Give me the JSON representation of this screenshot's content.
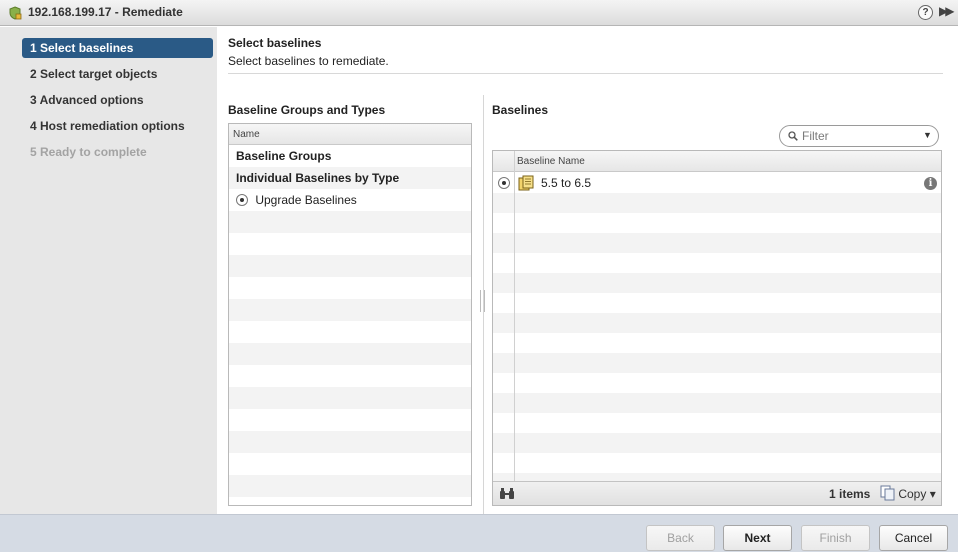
{
  "window": {
    "title": "192.168.199.17 - Remediate",
    "help_glyph": "?",
    "expand_glyph": "▶▶"
  },
  "steps": [
    {
      "label": "1  Select baselines",
      "state": "active"
    },
    {
      "label": "2  Select target objects",
      "state": "normal"
    },
    {
      "label": "3  Advanced options",
      "state": "normal"
    },
    {
      "label": "4  Host remediation options",
      "state": "normal"
    },
    {
      "label": "5  Ready to complete",
      "state": "disabled"
    }
  ],
  "main": {
    "heading": "Select baselines",
    "subheading": "Select baselines to remediate."
  },
  "left_panel": {
    "title": "Baseline Groups and Types",
    "column_header": "Name",
    "rows": [
      {
        "label": "Baseline Groups",
        "bold": true,
        "radio": false
      },
      {
        "label": "Individual Baselines by Type",
        "bold": true,
        "radio": false
      },
      {
        "label": "Upgrade Baselines",
        "bold": false,
        "radio": true
      }
    ]
  },
  "right_panel": {
    "title": "Baselines",
    "filter_placeholder": "Filter",
    "column_header": "Baseline Name",
    "rows": [
      {
        "name": "5.5 to 6.5",
        "icon": "upgrade-baseline-icon"
      }
    ],
    "items_count": "1 items",
    "copy_label": "Copy ▾"
  },
  "buttons": {
    "back": "Back",
    "next": "Next",
    "finish": "Finish",
    "cancel": "Cancel"
  },
  "colors": {
    "active_step": "#2a5a86",
    "bottom_bar": "#d5dbe4",
    "sidebar": "#e7e7e7"
  }
}
